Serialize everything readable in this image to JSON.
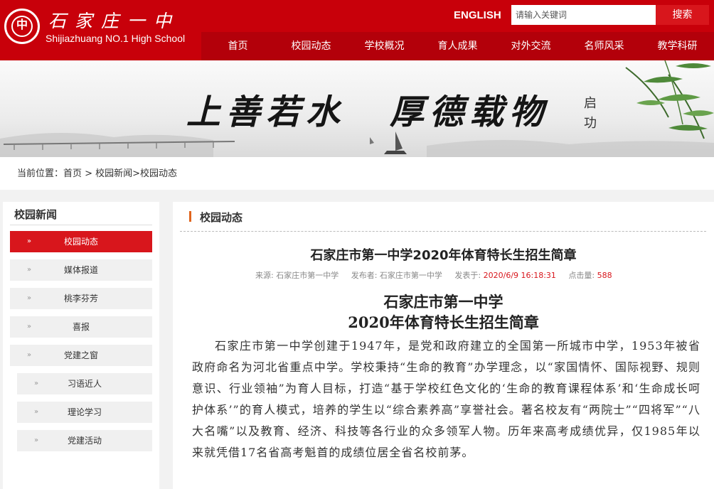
{
  "header": {
    "logo_mark": "中",
    "logo_cn": "石家庄一中",
    "logo_en": "Shijiazhuang NO.1 High School",
    "english_link": "ENGLISH",
    "search_placeholder": "请输入关键词",
    "search_button": "搜索",
    "accent_color": "#c8000a"
  },
  "nav": {
    "items": [
      "首页",
      "校园动态",
      "学校概况",
      "育人成果",
      "对外交流",
      "名师风采",
      "教学科研"
    ]
  },
  "banner": {
    "motto_left": "上善若水",
    "motto_right": "厚德载物",
    "signature": "启功"
  },
  "breadcrumb": {
    "text": "当前位置：首页 > 校园新闻>校园动态"
  },
  "sidebar": {
    "title": "校园新闻",
    "items": [
      "校园动态",
      "媒体报道",
      "桃李芬芳",
      "喜报",
      "党建之窗"
    ],
    "sub_items": [
      "习语近人",
      "理论学习",
      "党建活动"
    ],
    "active_index": 0
  },
  "main": {
    "section_title": "校园动态",
    "article_title": "石家庄市第一中学2020年体育特长生招生简章",
    "meta": {
      "source_label": "来源: 石家庄市第一中学",
      "publisher_label": "发布者: 石家庄市第一中学",
      "published_label": "发表于:",
      "published_value": "2020/6/9 16:18:31",
      "views_label": "点击量:",
      "views_value": "588"
    },
    "doc_title_line1": "石家庄市第一中学",
    "doc_title_line2": "2020年体育特长生招生简章",
    "paragraph": "石家庄市第一中学创建于1947年，是党和政府建立的全国第一所城市中学，1953年被省政府命名为河北省重点中学。学校秉持“生命的教育”办学理念，以“家国情怀、国际视野、规则意识、行业领袖”为育人目标，打造“基于学校红色文化的‘生命的教育课程体系’和‘生命成长呵护体系’”的育人模式，培养的学生以“综合素养高”享誉社会。著名校友有“两院士”“四将军”“八大名嘴”以及教育、经济、科技等各行业的众多领军人物。历年来高考成绩优异，仅1985年以来就凭借17名省高考魁首的成绩位居全省名校前茅。"
  }
}
